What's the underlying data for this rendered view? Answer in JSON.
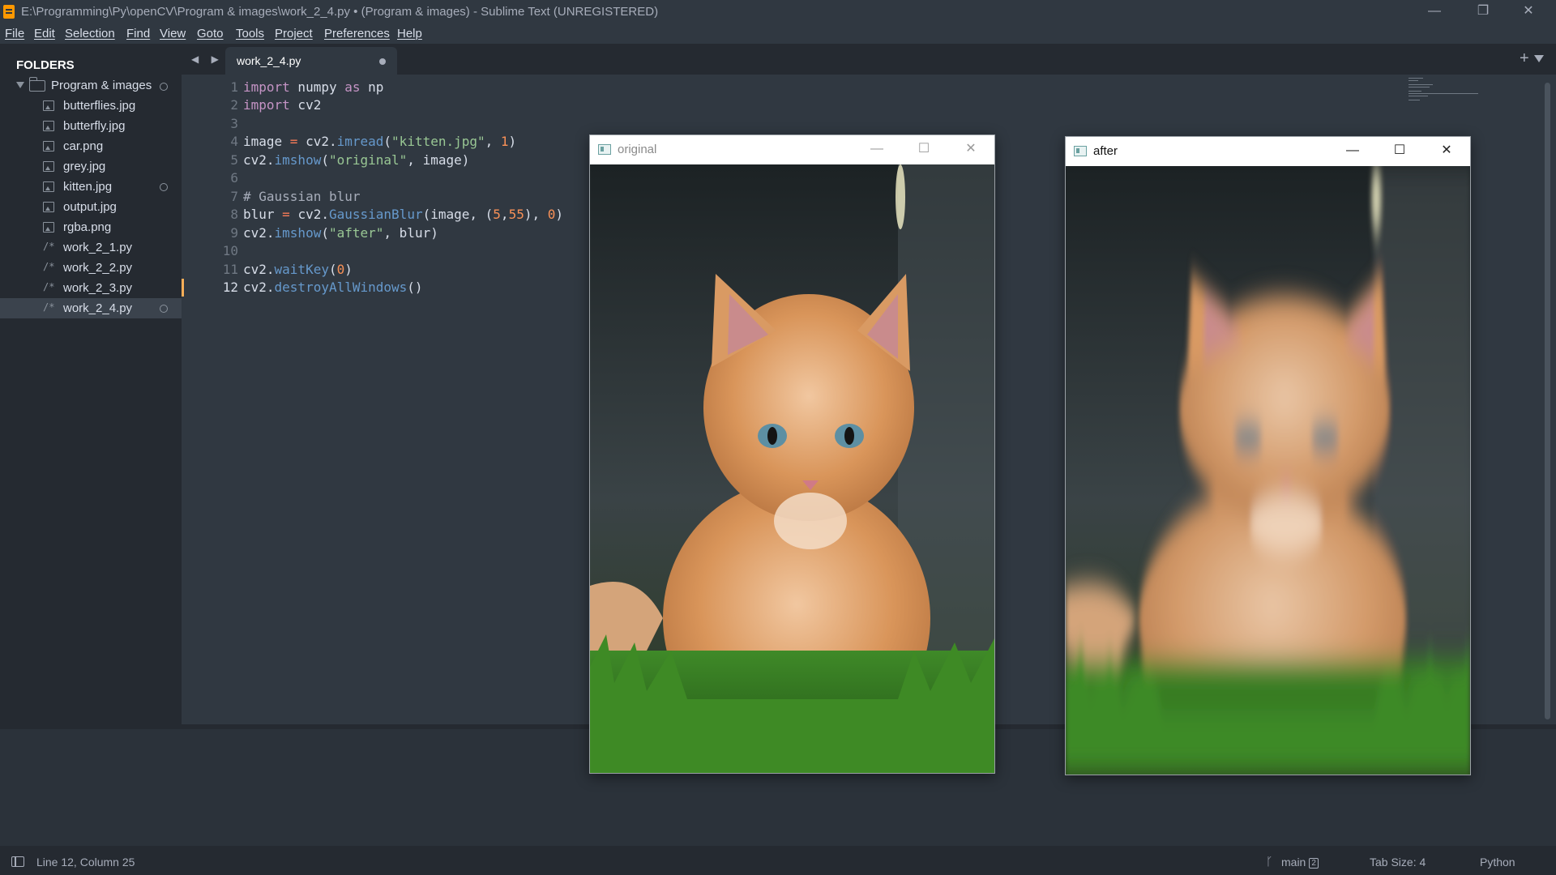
{
  "window": {
    "title": "E:\\Programming\\Py\\openCV\\Program & images\\work_2_4.py • (Program & images) - Sublime Text (UNREGISTERED)",
    "minimize": "—",
    "restore": "❐",
    "close": "✕"
  },
  "menu": [
    "File",
    "Edit",
    "Selection",
    "Find",
    "View",
    "Goto",
    "Tools",
    "Project",
    "Preferences",
    "Help"
  ],
  "sidebar": {
    "header": "FOLDERS",
    "folder": "Program & images",
    "files": [
      {
        "name": "butterflies.jpg",
        "type": "image"
      },
      {
        "name": "butterfly.jpg",
        "type": "image"
      },
      {
        "name": "car.png",
        "type": "image"
      },
      {
        "name": "grey.jpg",
        "type": "image"
      },
      {
        "name": "kitten.jpg",
        "type": "image"
      },
      {
        "name": "output.jpg",
        "type": "image"
      },
      {
        "name": "rgba.png",
        "type": "image"
      },
      {
        "name": "work_2_1.py",
        "type": "code"
      },
      {
        "name": "work_2_2.py",
        "type": "code"
      },
      {
        "name": "work_2_3.py",
        "type": "code"
      },
      {
        "name": "work_2_4.py",
        "type": "code"
      }
    ],
    "code_file_glyph": "/*"
  },
  "tabs": [
    {
      "label": "work_2_4.py",
      "active": true,
      "dirty": true
    }
  ],
  "tabbar": {
    "nav": "◀ ▶",
    "plus": "+"
  },
  "editor": {
    "line_numbers": [
      "1",
      "2",
      "3",
      "4",
      "5",
      "6",
      "7",
      "8",
      "9",
      "10",
      "11",
      "12"
    ],
    "current_line": 12,
    "code": {
      "l1_kw": "import",
      "l1_rest": " numpy ",
      "l1_as": "as",
      "l1_np": " np",
      "l2_kw": "import",
      "l2_rest": " cv2",
      "l4_a": "image ",
      "l4_eq": "=",
      "l4_b": " cv2.",
      "l4_fn": "imread",
      "l4_c": "(",
      "l4_str": "\"kitten.jpg\"",
      "l4_d": ", ",
      "l4_num": "1",
      "l4_e": ")",
      "l5_a": "cv2.",
      "l5_fn": "imshow",
      "l5_b": "(",
      "l5_str": "\"original\"",
      "l5_c": ", image)",
      "l7_cm": "# Gaussian blur",
      "l8_a": "blur ",
      "l8_eq": "=",
      "l8_b": " cv2.",
      "l8_fn": "GaussianBlur",
      "l8_c": "(image, (",
      "l8_n1": "5",
      "l8_d": ",",
      "l8_n2": "55",
      "l8_e": "), ",
      "l8_n3": "0",
      "l8_f": ")",
      "l9_a": "cv2.",
      "l9_fn": "imshow",
      "l9_b": "(",
      "l9_str": "\"after\"",
      "l9_c": ", blur)",
      "l11_a": "cv2.",
      "l11_fn": "waitKey",
      "l11_b": "(",
      "l11_num": "0",
      "l11_c": ")",
      "l12_a": "cv2.",
      "l12_fn": "destroyAllWindows",
      "l12_b": "()"
    }
  },
  "status": {
    "position": "Line 12, Column 25",
    "branch": "main",
    "branch_count": "2",
    "branch_glyph": "ᚴ",
    "tab_size": "Tab Size: 4",
    "syntax": "Python"
  },
  "image_windows": [
    {
      "title": "original",
      "state": "inactive",
      "blurred": false
    },
    {
      "title": "after",
      "state": "active",
      "blurred": true
    }
  ],
  "image_window_controls": {
    "minimize": "—",
    "maximize": "☐",
    "close": "✕"
  },
  "colors": {
    "accent": "#f9ae58",
    "background": "#303841",
    "sidebar": "#252a31"
  }
}
